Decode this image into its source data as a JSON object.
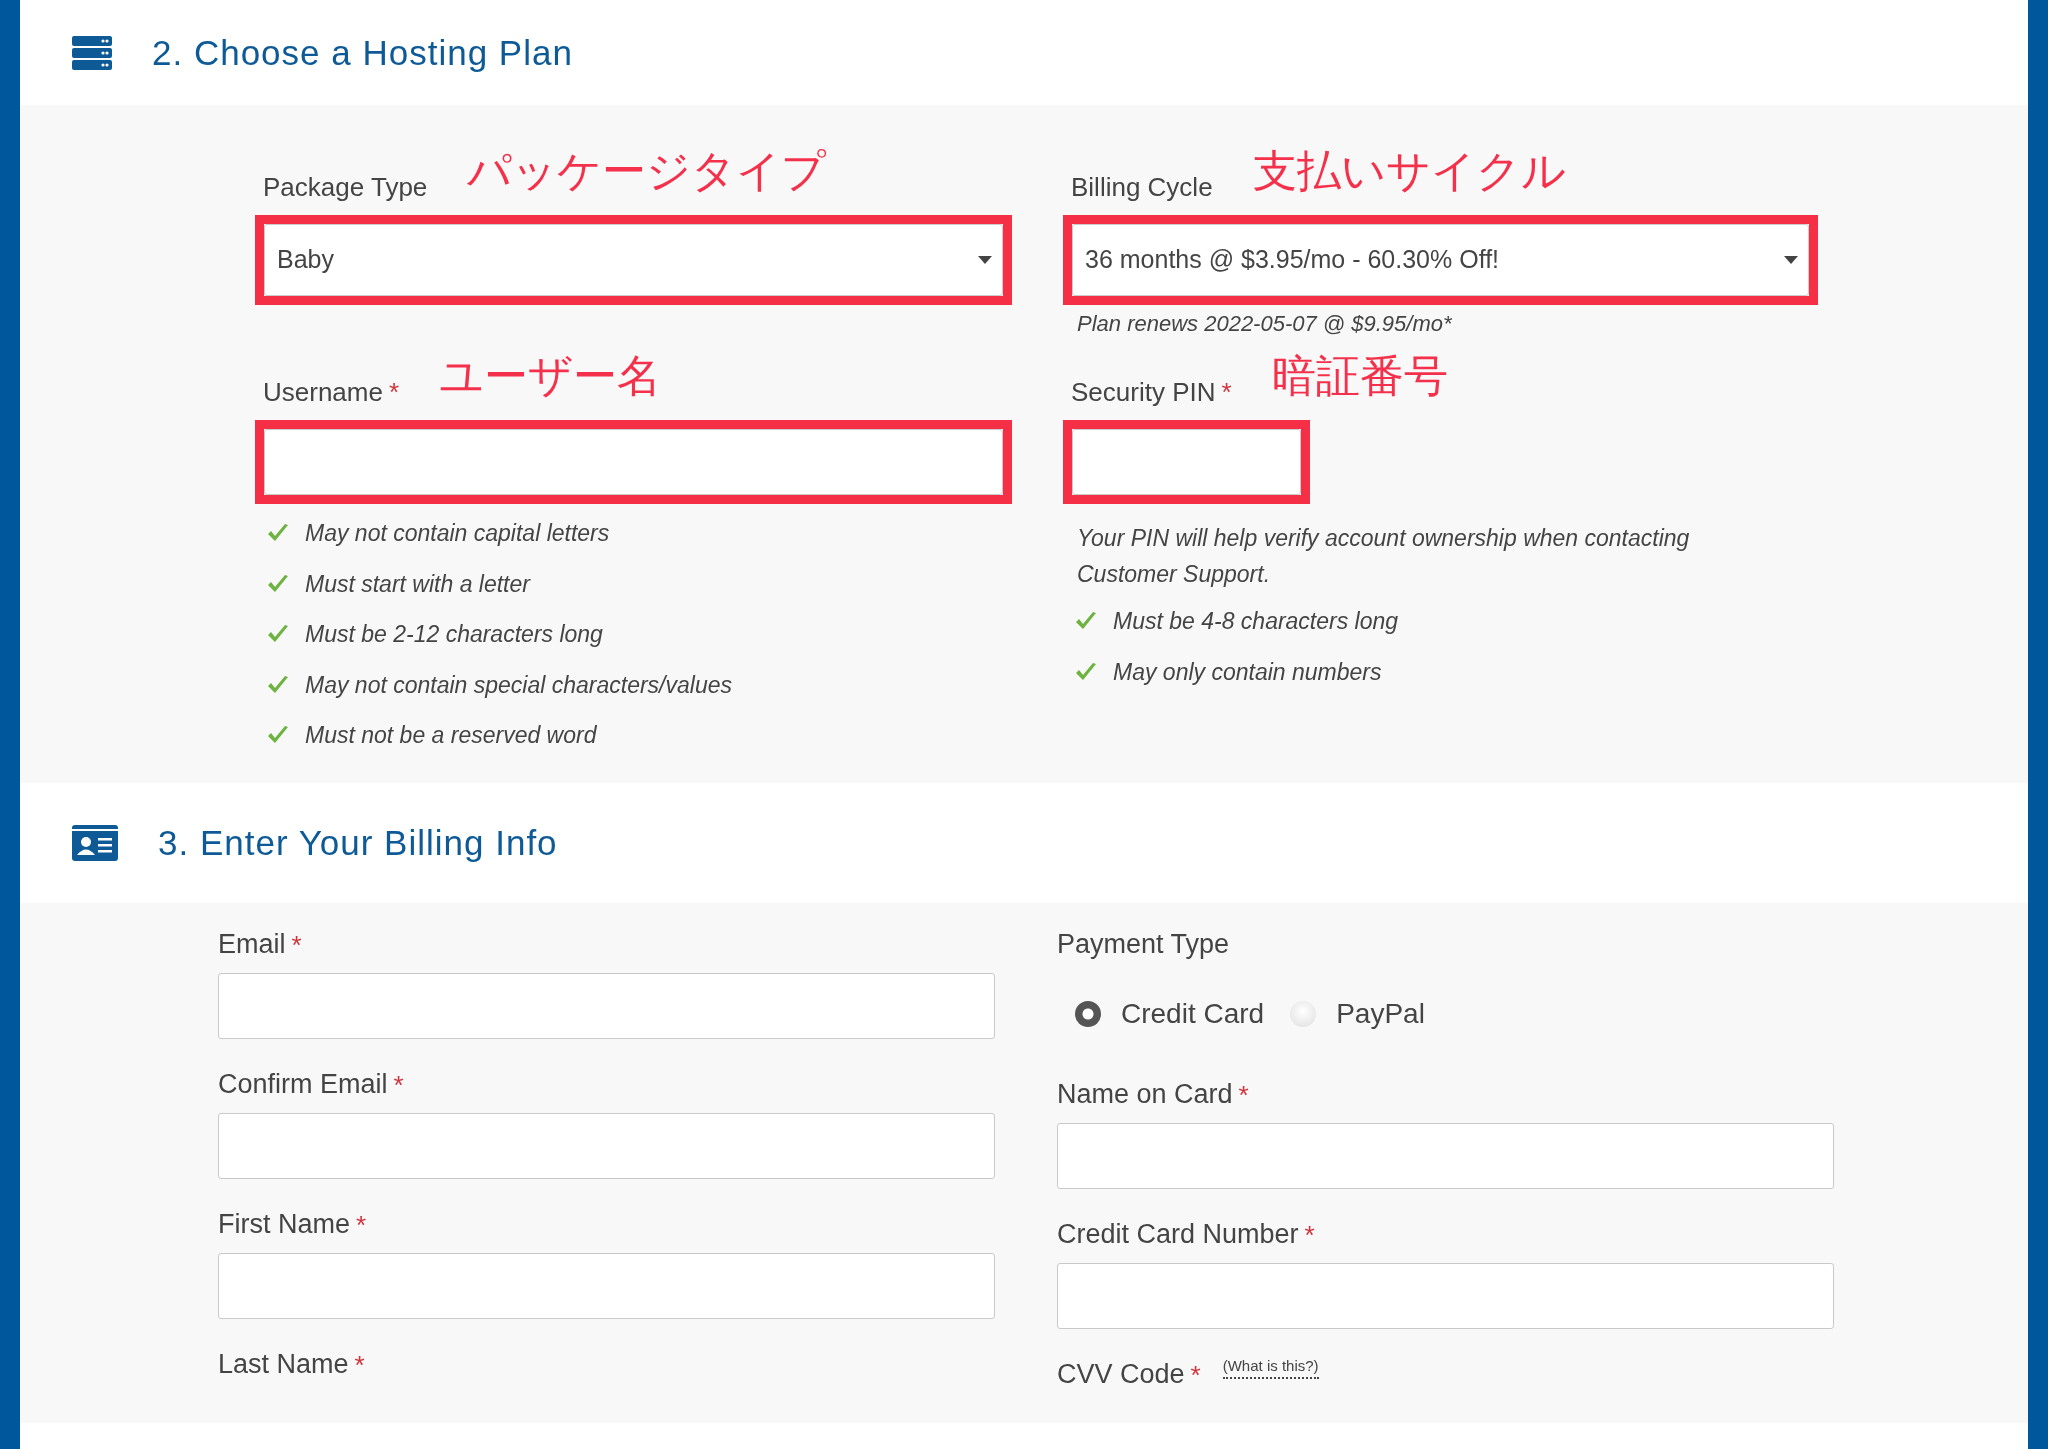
{
  "plan_section": {
    "title": "2. Choose a Hosting Plan",
    "fields": [
      {
        "kind": "select",
        "label": "Package Type",
        "value": "Baby",
        "annotation": "パッケージタイプ",
        "highlighted": true
      },
      {
        "kind": "select",
        "label": "Billing Cycle",
        "value": "36 months @ $3.95/mo - 60.30% Off!",
        "note": "Plan renews 2022-05-07 @ $9.95/mo*",
        "annotation": "支払いサイクル",
        "highlighted": true
      },
      {
        "kind": "text",
        "label": "Username",
        "required_mark": "*",
        "annotation": "ユーザー名",
        "highlighted": true,
        "rules": [
          {
            "text": "May not contain capital letters",
            "passed": true
          },
          {
            "text": "Must start with a letter",
            "passed": true
          },
          {
            "text": "Must be 2-12 characters long",
            "passed": true
          },
          {
            "text": "May not contain special characters/values",
            "passed": true
          },
          {
            "text": "Must not be a reserved word",
            "passed": true
          }
        ]
      },
      {
        "kind": "pin",
        "label": "Security PIN",
        "required_mark": "*",
        "annotation": "暗証番号",
        "highlighted": true,
        "help": "Your PIN will help verify account ownership when contacting Customer Support.",
        "rules": [
          {
            "text": "Must be 4-8 characters long",
            "passed": true
          },
          {
            "text": "May only contain numbers",
            "passed": true
          }
        ]
      }
    ]
  },
  "billing_section": {
    "title": "3. Enter Your Billing Info",
    "left_fields": [
      {
        "kind": "text",
        "label": "Email",
        "required_mark": "*"
      },
      {
        "kind": "text",
        "label": "Confirm Email",
        "required_mark": "*"
      },
      {
        "kind": "text",
        "label": "First Name",
        "required_mark": "*"
      },
      {
        "kind": "label",
        "label": "Last Name",
        "required_mark": "*"
      }
    ],
    "right_fields": [
      {
        "kind": "radio",
        "label": "Payment Type",
        "options": [
          {
            "label": "Credit Card",
            "selected": true
          },
          {
            "label": "PayPal",
            "selected": false
          }
        ]
      },
      {
        "kind": "text",
        "label": "Name on Card",
        "required_mark": "*"
      },
      {
        "kind": "text",
        "label": "Credit Card Number",
        "required_mark": "*"
      },
      {
        "kind": "label",
        "label": "CVV Code",
        "required_mark": "*",
        "link": "(What is this?)"
      }
    ]
  }
}
